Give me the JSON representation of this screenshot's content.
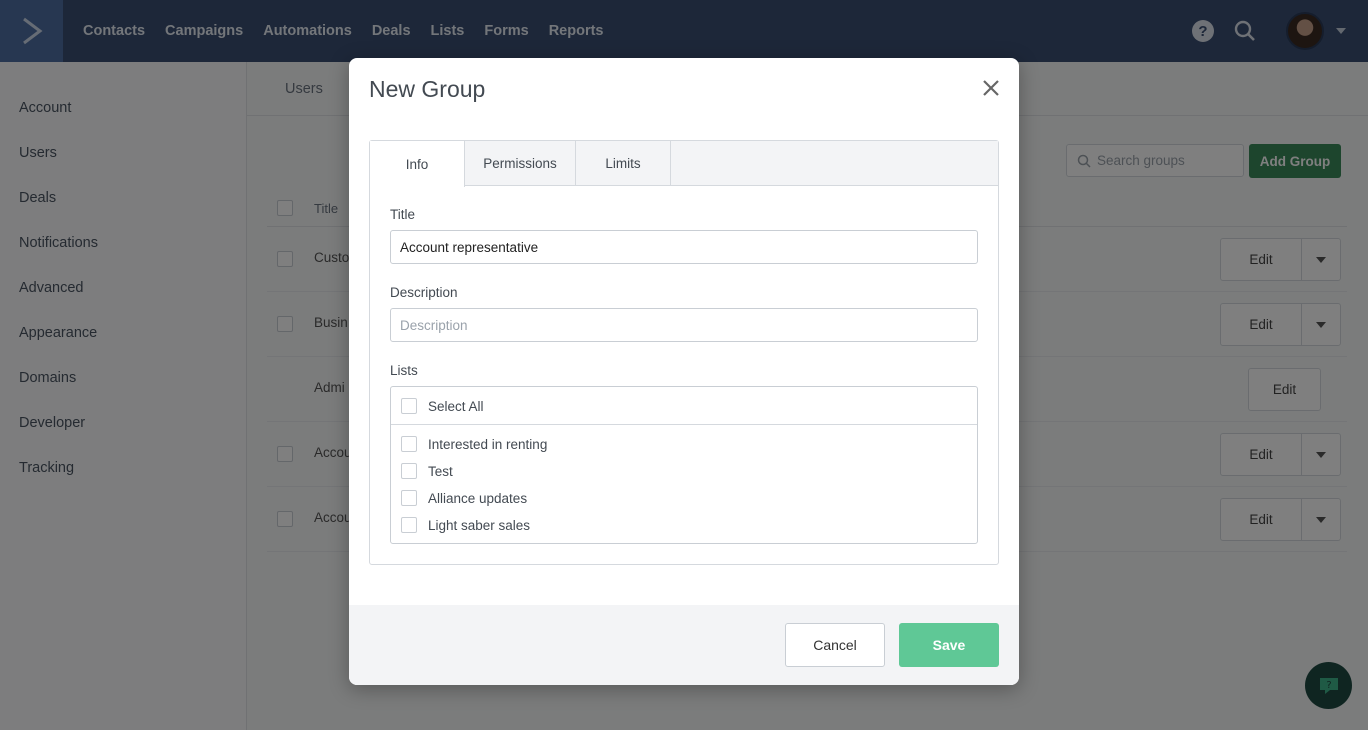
{
  "nav": {
    "items": [
      "Contacts",
      "Campaigns",
      "Automations",
      "Deals",
      "Lists",
      "Forms",
      "Reports"
    ],
    "help_label": "?"
  },
  "sidebar": {
    "items": [
      "Account",
      "Users",
      "Deals",
      "Notifications",
      "Advanced",
      "Appearance",
      "Domains",
      "Developer",
      "Tracking"
    ]
  },
  "main": {
    "tab_users": "Users",
    "search_placeholder": "Search groups",
    "add_group": "Add Group",
    "col_title": "Title",
    "rows": [
      {
        "title": "Custo",
        "edit": "Edit"
      },
      {
        "title": "Busin",
        "edit": "Edit"
      },
      {
        "title": "Admi",
        "edit": "Edit"
      },
      {
        "title": "Accou",
        "edit": "Edit"
      },
      {
        "title": "Accou",
        "edit": "Edit"
      }
    ]
  },
  "modal": {
    "title": "New Group",
    "tabs": [
      "Info",
      "Permissions",
      "Limits"
    ],
    "title_label": "Title",
    "title_value": "Account representative",
    "description_label": "Description",
    "description_placeholder": "Description",
    "lists_label": "Lists",
    "select_all": "Select All",
    "lists": [
      "Interested in renting",
      "Test",
      "Alliance updates",
      "Light saber sales"
    ],
    "cancel": "Cancel",
    "save": "Save"
  },
  "colors": {
    "nav_bg": "#3a4f73",
    "save": "#5fc896",
    "add_group": "#3a8a5b"
  }
}
